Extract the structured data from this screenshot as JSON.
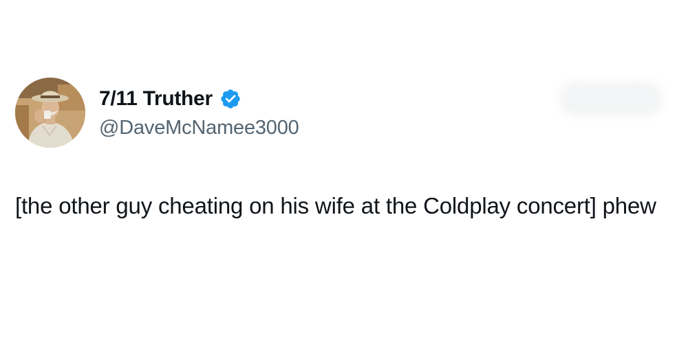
{
  "tweet": {
    "author": {
      "display_name": "7/11 Truther",
      "handle": "@DaveMcNamee3000",
      "verified": true,
      "avatar_icon": "profile-photo-man-in-hat"
    },
    "text": "[the other guy cheating on his wife at the Coldplay concert] phew"
  },
  "colors": {
    "background": "#ffffff",
    "text_primary": "#0f1419",
    "text_secondary": "#536471",
    "verified_blue": "#1d9bf0"
  }
}
